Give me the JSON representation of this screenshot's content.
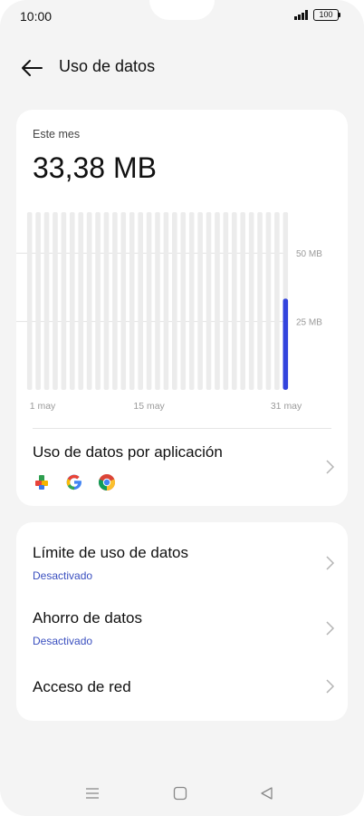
{
  "status_bar": {
    "time": "10:00",
    "battery": "100",
    "signal_bars": 4
  },
  "header": {
    "title": "Uso de datos",
    "back_icon": "arrow-left-icon"
  },
  "summary": {
    "period_label": "Este mes",
    "total": "33,38 MB"
  },
  "chart_data": {
    "type": "bar",
    "x_tick_labels": [
      "1 may",
      "15 may",
      "31 may"
    ],
    "y_tick_labels": [
      "50 MB",
      "25 MB"
    ],
    "categories": [
      "1",
      "2",
      "3",
      "4",
      "5",
      "6",
      "7",
      "8",
      "9",
      "10",
      "11",
      "12",
      "13",
      "14",
      "15",
      "16",
      "17",
      "18",
      "19",
      "20",
      "21",
      "22",
      "23",
      "24",
      "25",
      "26",
      "27",
      "28",
      "29",
      "30",
      "31"
    ],
    "values": [
      0,
      0,
      0,
      0,
      0,
      0,
      0,
      0,
      0,
      0,
      0,
      0,
      0,
      0,
      0,
      0,
      0,
      0,
      0,
      0,
      0,
      0,
      0,
      0,
      0,
      0,
      0,
      0,
      0,
      0,
      33.38
    ],
    "ylim": [
      0,
      65
    ],
    "unit": "MB",
    "bar_color": "#3344dd",
    "track_color": "#ececec"
  },
  "app_usage": {
    "title": "Uso de datos por aplicación",
    "icons": [
      "puzzle-app-icon",
      "google-icon",
      "chrome-icon"
    ]
  },
  "settings": [
    {
      "title": "Límite de uso de datos",
      "subtitle": "Desactivado"
    },
    {
      "title": "Ahorro de datos",
      "subtitle": "Desactivado"
    },
    {
      "title": "Acceso de red"
    }
  ],
  "colors": {
    "accent": "#3a4fbf",
    "bar": "#3344dd",
    "background": "#f4f4f4"
  },
  "nav_bar": {
    "icons": [
      "menu-icon",
      "home-icon",
      "back-triangle-icon"
    ]
  }
}
